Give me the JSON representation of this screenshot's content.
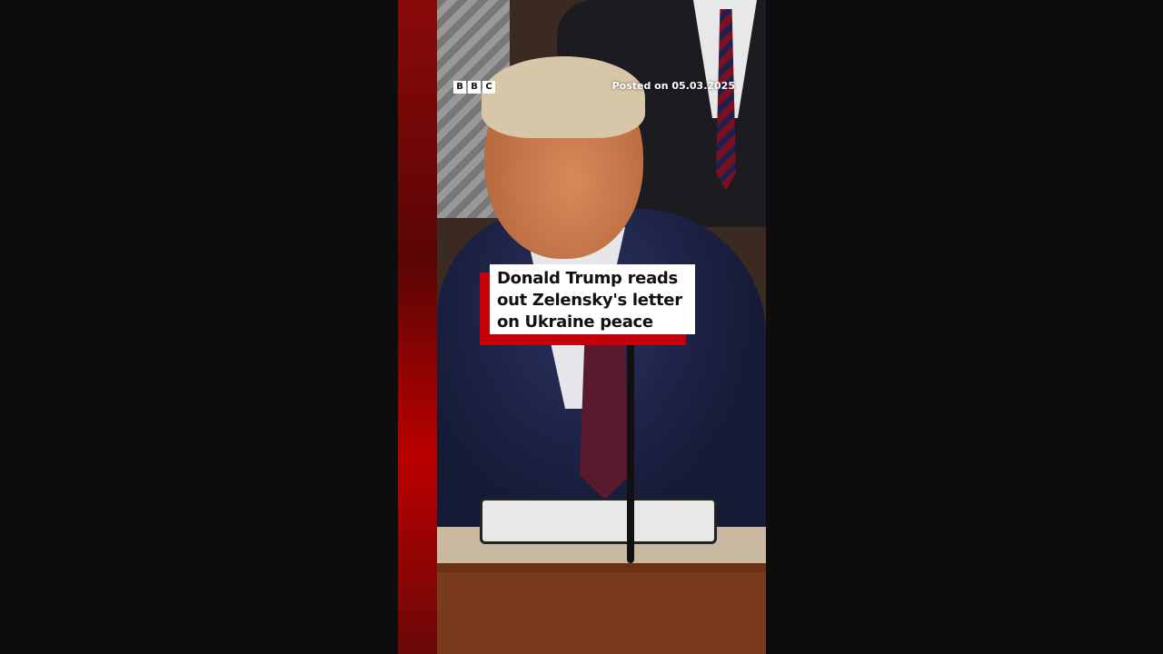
{
  "logo": "BBC",
  "posted": "Posted on 05.03.2025",
  "caption": {
    "lines": [
      "Donald Trump reads",
      "out Zelensky's letter",
      "on Ukraine peace"
    ]
  },
  "colors": {
    "accent": "#c4000b"
  }
}
